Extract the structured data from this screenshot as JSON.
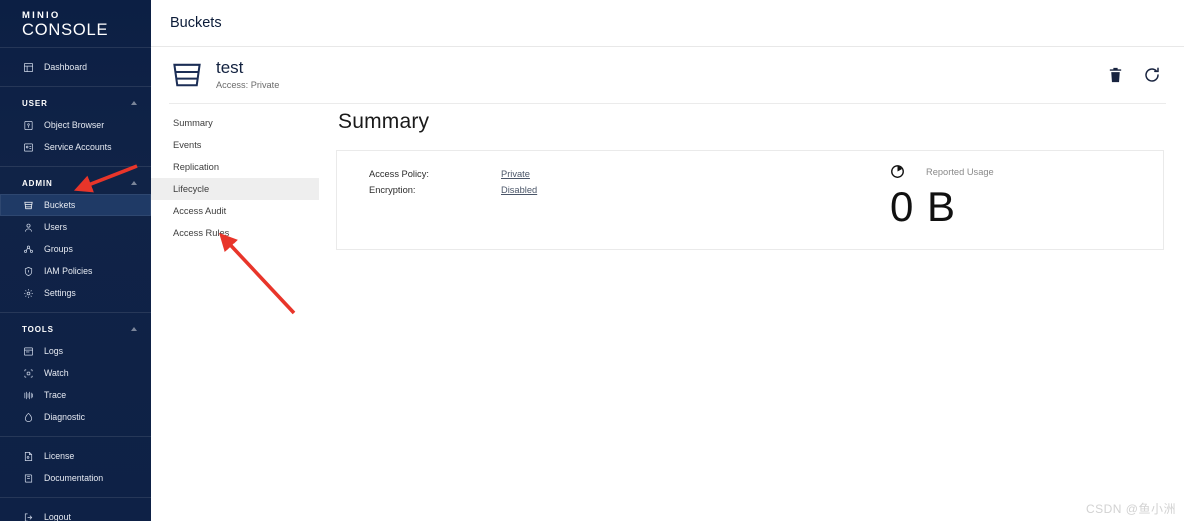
{
  "sidebar": {
    "logo_top": "MINIO",
    "logo_bottom": "CONSOLE",
    "top_items": [
      {
        "label": "Dashboard",
        "icon": "dashboard-icon"
      }
    ],
    "sections": [
      {
        "title": "USER",
        "items": [
          {
            "label": "Object Browser",
            "icon": "object-browser-icon"
          },
          {
            "label": "Service Accounts",
            "icon": "service-accounts-icon"
          }
        ]
      },
      {
        "title": "ADMIN",
        "items": [
          {
            "label": "Buckets",
            "icon": "bucket-icon",
            "active": true
          },
          {
            "label": "Users",
            "icon": "user-icon"
          },
          {
            "label": "Groups",
            "icon": "groups-icon"
          },
          {
            "label": "IAM Policies",
            "icon": "shield-icon"
          },
          {
            "label": "Settings",
            "icon": "gear-icon"
          }
        ]
      },
      {
        "title": "TOOLS",
        "items": [
          {
            "label": "Logs",
            "icon": "logs-icon"
          },
          {
            "label": "Watch",
            "icon": "watch-icon"
          },
          {
            "label": "Trace",
            "icon": "trace-icon"
          },
          {
            "label": "Diagnostic",
            "icon": "diagnostic-icon"
          }
        ]
      }
    ],
    "footer_items": [
      {
        "label": "License",
        "icon": "license-icon"
      },
      {
        "label": "Documentation",
        "icon": "documentation-icon"
      }
    ],
    "logout_item": {
      "label": "Logout",
      "icon": "logout-icon"
    }
  },
  "topbar": {
    "title": "Buckets"
  },
  "bucket": {
    "name": "test",
    "access": "Access: Private",
    "delete_tooltip": "Delete Bucket",
    "refresh_tooltip": "Refresh"
  },
  "subnav": {
    "items": [
      {
        "label": "Summary"
      },
      {
        "label": "Events"
      },
      {
        "label": "Replication"
      },
      {
        "label": "Lifecycle",
        "active": true
      },
      {
        "label": "Access Audit"
      },
      {
        "label": "Access Rules"
      }
    ]
  },
  "summary": {
    "title": "Summary",
    "rows": [
      {
        "label": "Access Policy:",
        "value": "Private"
      },
      {
        "label": "Encryption:",
        "value": "Disabled"
      }
    ],
    "usage": {
      "label": "Reported Usage",
      "value": "0 B"
    }
  },
  "annotations": {
    "arrow_color": "#e8352a",
    "arrow_one": "points at Buckets sidebar item",
    "arrow_two": "points at Access Rules sub-nav item"
  },
  "watermark": {
    "text": "CSDN @鱼小洲"
  },
  "colors": {
    "sidebar_bg": "#0e2146",
    "sidebar_active": "#1f3a66",
    "accent_dark": "#12213f",
    "arrow_red": "#e8352a"
  }
}
